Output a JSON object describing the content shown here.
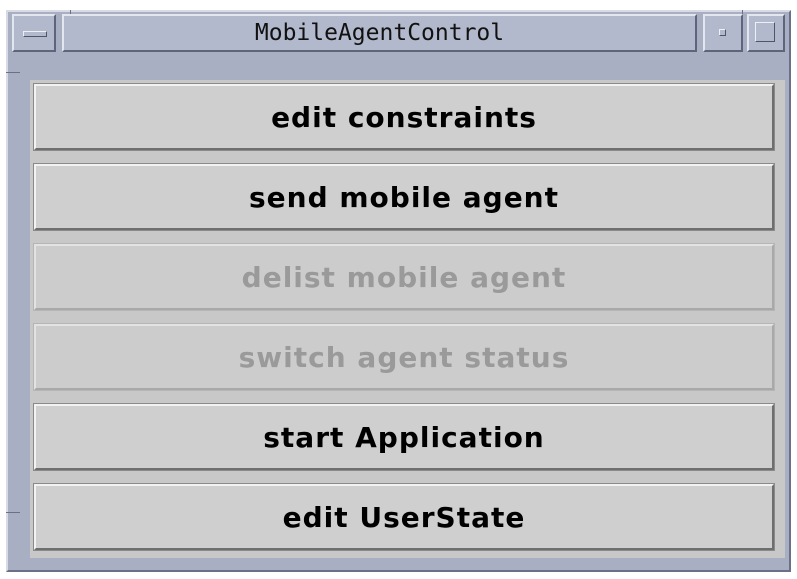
{
  "window": {
    "title": "MobileAgentControl",
    "controls": {
      "menu_icon": "window-menu-icon",
      "minimize_icon": "minimize-icon",
      "maximize_icon": "maximize-icon"
    }
  },
  "buttons": [
    {
      "label": "edit constraints",
      "enabled": true
    },
    {
      "label": "send mobile agent",
      "enabled": true
    },
    {
      "label": "delist mobile agent",
      "enabled": false
    },
    {
      "label": "switch agent status",
      "enabled": false
    },
    {
      "label": "start Application",
      "enabled": true
    },
    {
      "label": "edit UserState",
      "enabled": true
    }
  ],
  "colors": {
    "frame": "#a9afc3",
    "button_face": "#cfcfcf",
    "enabled_text": "#000000",
    "disabled_text": "#9a9a9a"
  }
}
